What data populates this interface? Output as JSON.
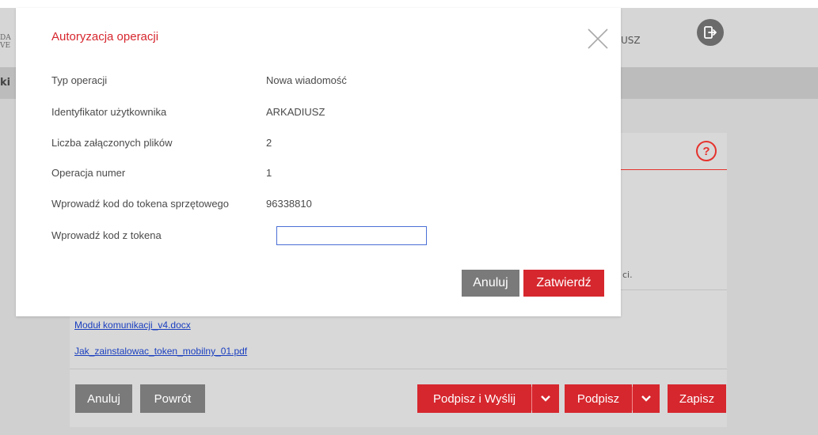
{
  "background": {
    "logo_fragment_1": "DA",
    "logo_fragment_2": "VE",
    "user_fragment": "USZ",
    "nav_fragment": "ki",
    "help_symbol": "?",
    "content_fragment": "ci.",
    "attachments": [
      "Moduł komunikacji_v4.docx",
      "Jak_zainstalowac_token_mobilny_01.pdf"
    ],
    "footer": {
      "cancel_label": "Anuluj",
      "back_label": "Powrót",
      "sign_send_label": "Podpisz i Wyślij",
      "sign_label": "Podpisz",
      "save_label": "Zapisz"
    }
  },
  "modal": {
    "title": "Autoryzacja operacji",
    "rows": [
      {
        "label": "Typ operacji",
        "value": "Nowa wiadomość"
      },
      {
        "label": "Identyfikator użytkownika",
        "value": "ARKADIUSZ"
      },
      {
        "label": "Liczba załączonych plików",
        "value": "2"
      },
      {
        "label": "Operacja numer",
        "value": "1"
      },
      {
        "label": "Wprowadź kod do tokena sprzętowego",
        "value": "96338810"
      }
    ],
    "token_input_label": "Wprowadź kod z tokena",
    "token_input_value": "",
    "cancel_label": "Anuluj",
    "confirm_label": "Zatwierdź"
  },
  "colors": {
    "accent_red": "#d6272e",
    "button_gray": "#7a7a7a",
    "link_blue": "#1a3fbf"
  },
  "icons": {
    "close": "close-icon",
    "help": "help-icon",
    "logout": "logout-icon",
    "chevron": "chevron-down-icon"
  }
}
